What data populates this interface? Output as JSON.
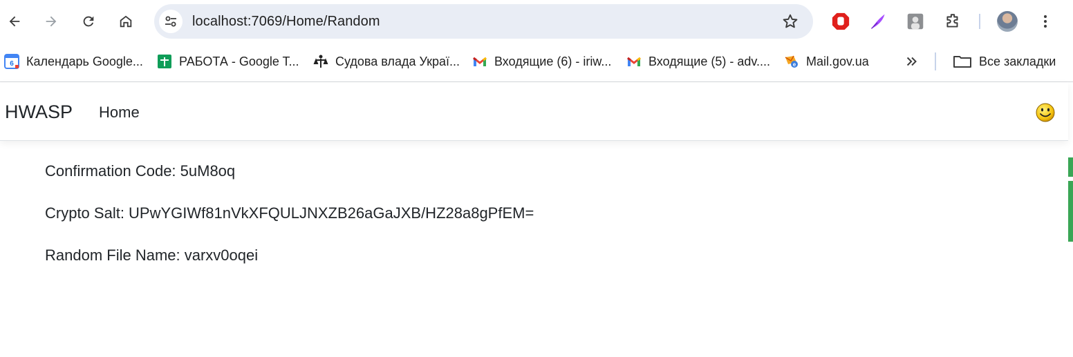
{
  "browser": {
    "url": "localhost:7069/Home/Random",
    "accent": "#e9edf5"
  },
  "bookmarks": [
    {
      "label": "Календарь Google...",
      "icon": "google-calendar-icon"
    },
    {
      "label": "РАБОТА - Google T...",
      "icon": "google-sheets-icon"
    },
    {
      "label": "Судова влада Украї...",
      "icon": "court-icon"
    },
    {
      "label": "Входящие (6) - iriw...",
      "icon": "gmail-icon"
    },
    {
      "label": "Входящие (5) - adv....",
      "icon": "gmail-icon"
    },
    {
      "label": "Mail.gov.ua",
      "icon": "mail-gov-icon"
    }
  ],
  "all_bookmarks_label": "Все закладки",
  "app": {
    "brand": "HWASP",
    "nav_home": "Home"
  },
  "content": {
    "confirmation_code": "Confirmation Code: 5uM8oq",
    "crypto_salt": "Crypto Salt: UPwYGIWf81nVkXFQULJNXZB26aGaJXB/HZ28a8gPfEM=",
    "random_file_name": "Random File Name: varxv0oqei"
  }
}
